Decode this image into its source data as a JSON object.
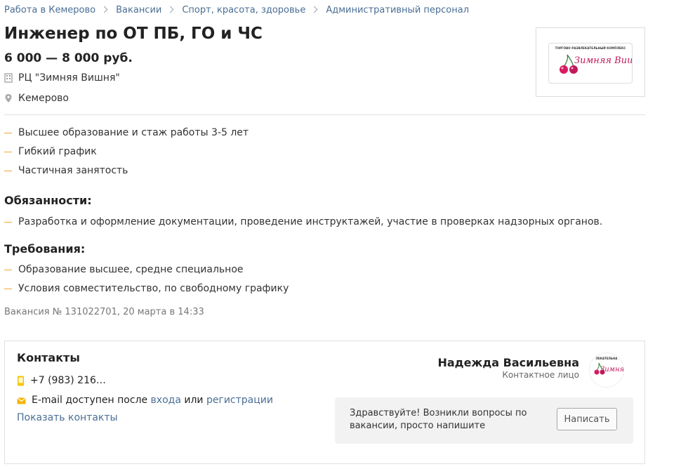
{
  "breadcrumbs": [
    "Работа в Кемерово",
    "Вакансии",
    "Спорт, красота, здоровье",
    "Административный персонал"
  ],
  "vacancy": {
    "title": "Инженер по ОТ ПБ, ГО и ЧС",
    "salary": "6 000 — 8 000 руб.",
    "company": "РЦ \"Зимняя Вишня\"",
    "city": "Кемерово"
  },
  "logo": {
    "top_text": "ТОРГОВО РАЗВЛЕКАТЕЛЬНЫЙ КОМПЛЕКС",
    "script_text": "Зимняя Вишня"
  },
  "highlights": [
    "Высшее образование и стаж работы 3-5 лет",
    "Гибкий график",
    "Частичная занятость"
  ],
  "duties": {
    "title": "Обязанности:",
    "items": [
      "Разработка и оформление документации, проведение инструктажей, участие в проверках надзорных органов."
    ]
  },
  "requirements": {
    "title": "Требования:",
    "items": [
      "Образование высшее, средне специальное",
      "Условия совместительство, по свободному графику"
    ]
  },
  "vacancy_number": "Вакансия № 131022701, 20 марта в 14:33",
  "contacts": {
    "title": "Контакты",
    "phone": "+7 (983) 216…",
    "email_prefix": "E-mail доступен после",
    "login_link": "входа",
    "or_text": "или",
    "register_link": "регистрации",
    "show_contacts": "Показать контакты",
    "person_name": "Надежда Васильевна",
    "person_role": "Контактное лицо",
    "avatar_top": "ЛЕКАТЕЛЬНА",
    "avatar_script": "Зимняя Ви",
    "message": "Здравствуйте! Возникли вопросы по вакансии, просто напишите",
    "write_button": "Написать"
  },
  "colors": {
    "link": "#4a6e94",
    "bullet_dash": "#f0a63a",
    "brand_script": "#c2185b",
    "phone_icon": "#f5c400",
    "email_icon": "#f5b400"
  }
}
